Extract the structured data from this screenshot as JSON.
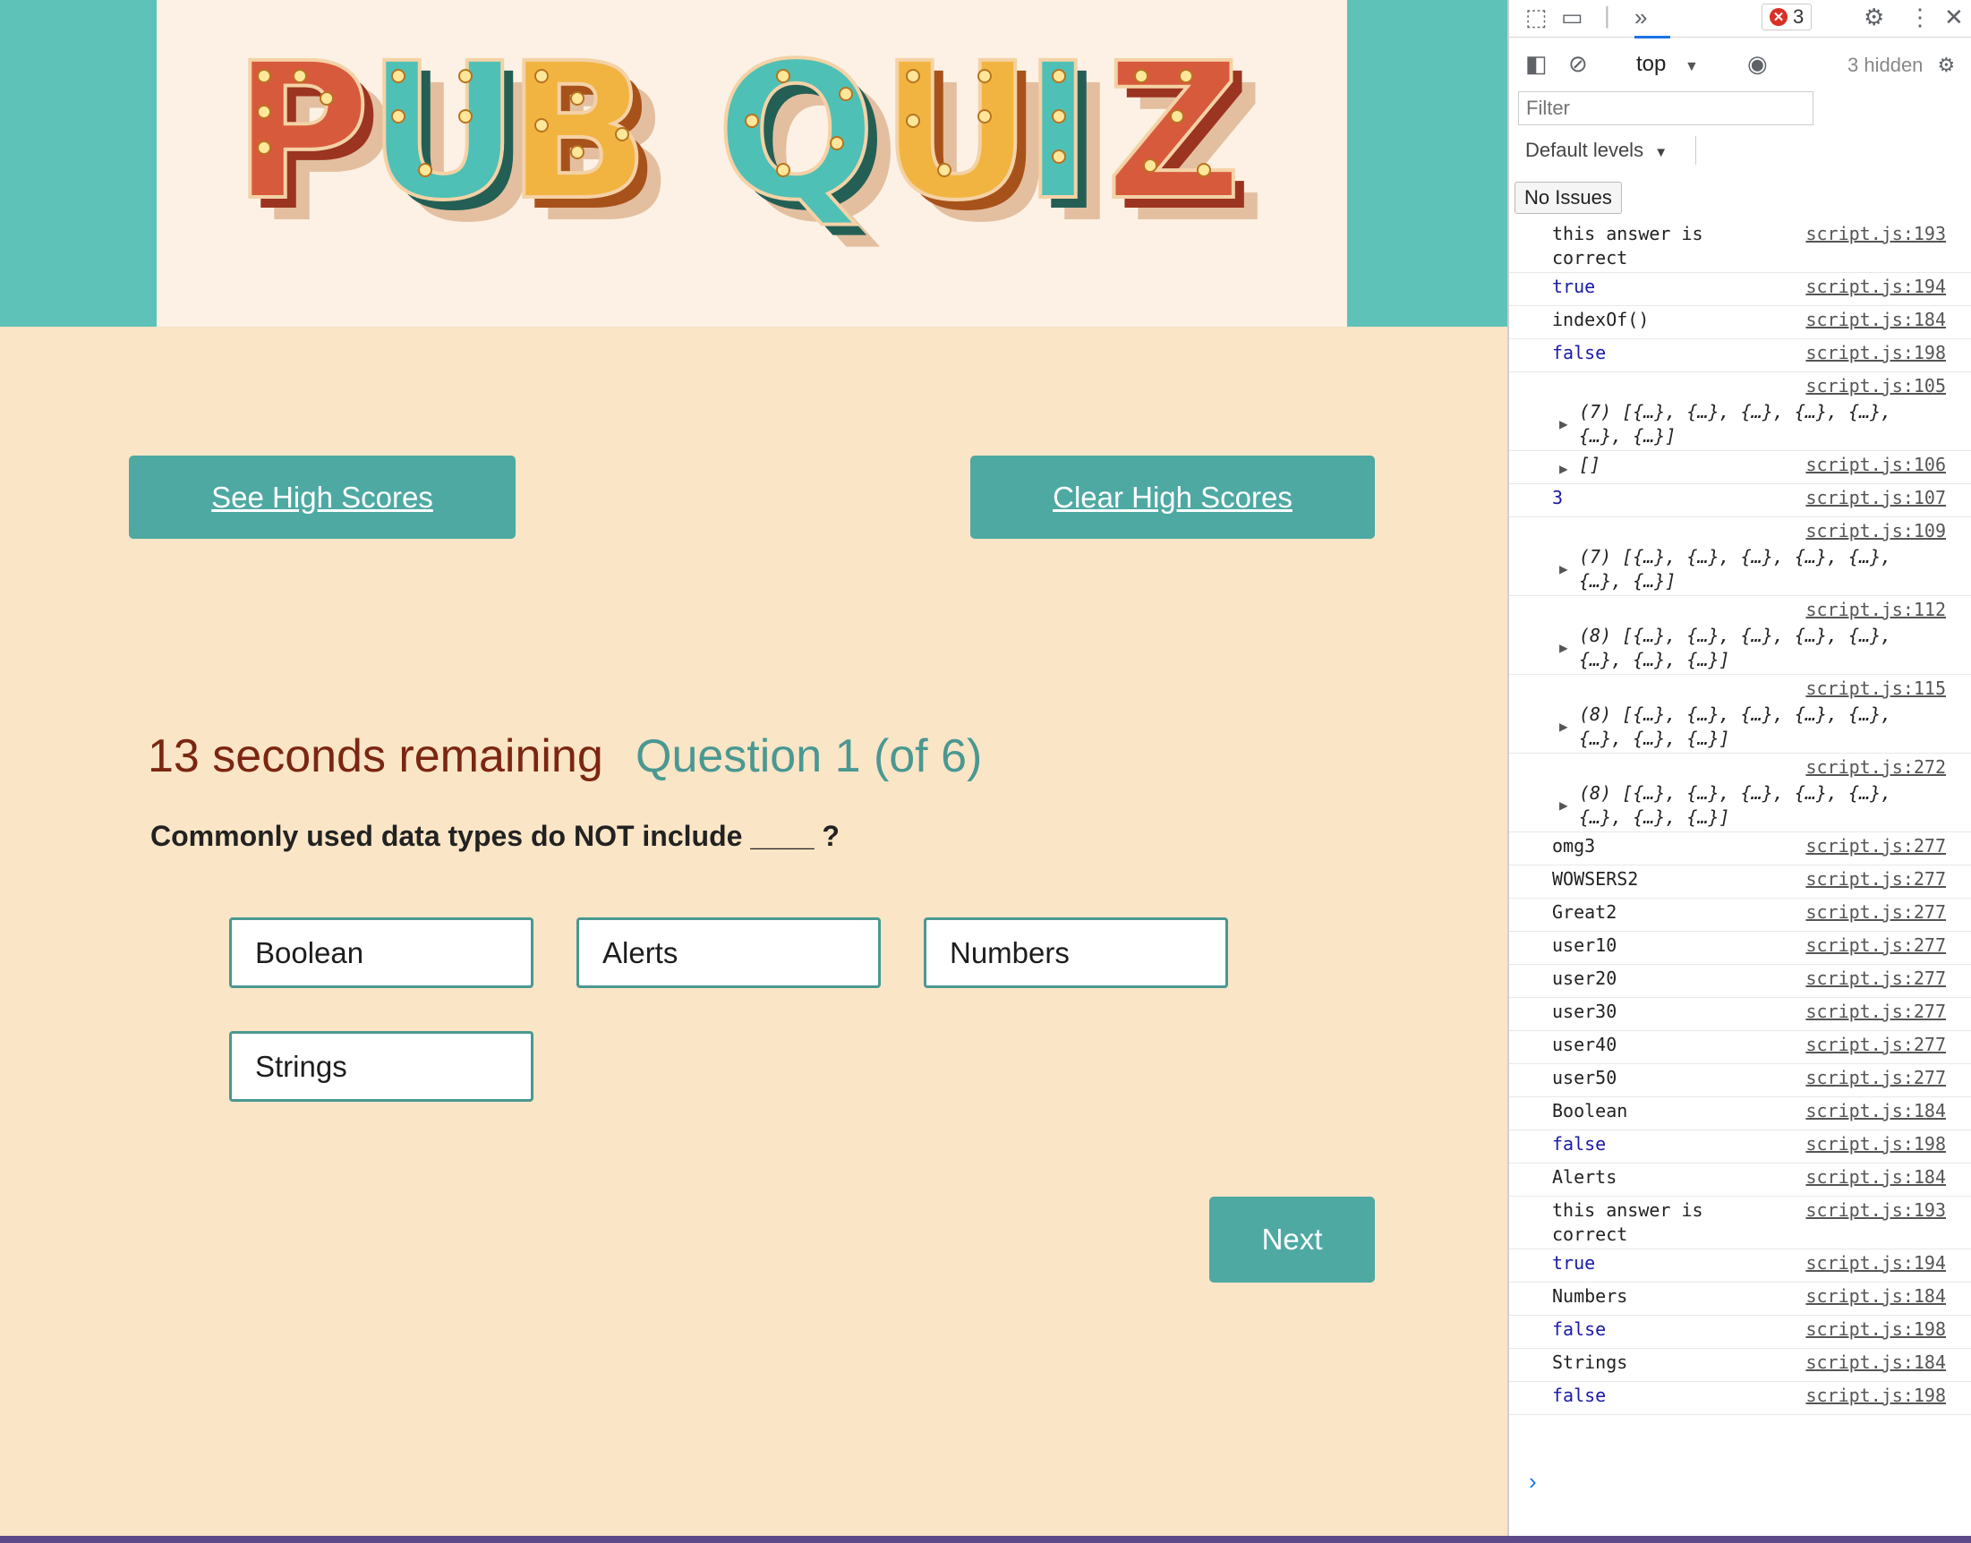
{
  "banner": {
    "logo_text": "PUB QUIZ"
  },
  "buttons": {
    "see_high_scores": "See High Scores",
    "clear_high_scores": "Clear High Scores",
    "next": "Next"
  },
  "quiz": {
    "timer": "13 seconds remaining",
    "question_number": "Question 1 (of 6)",
    "question": "Commonly used data types do NOT include ____ ?",
    "answers": [
      "Boolean",
      "Alerts",
      "Numbers",
      "Strings"
    ]
  },
  "devtools": {
    "error_count": "3",
    "context": "top",
    "hidden": "3 hidden",
    "filter_placeholder": "Filter",
    "levels": "Default levels",
    "issues": "No Issues",
    "logs": [
      {
        "msg": "this answer is\ncorrect",
        "src": "script.js:193",
        "kind": "text"
      },
      {
        "msg": "true",
        "src": "script.js:194",
        "kind": "bool"
      },
      {
        "msg": "indexOf()",
        "src": "script.js:184",
        "kind": "text"
      },
      {
        "msg": "false",
        "src": "script.js:198",
        "kind": "bool"
      },
      {
        "msg": "(7) [{…}, {…}, {…}, {…}, {…},\n{…}, {…}]",
        "src": "script.js:105",
        "kind": "expand"
      },
      {
        "msg": "[]",
        "src": "script.js:106",
        "kind": "inline-expand"
      },
      {
        "msg": "3",
        "src": "script.js:107",
        "kind": "num"
      },
      {
        "msg": "(7) [{…}, {…}, {…}, {…}, {…},\n{…}, {…}]",
        "src": "script.js:109",
        "kind": "expand"
      },
      {
        "msg": "(8) [{…}, {…}, {…}, {…}, {…},\n{…}, {…}, {…}]",
        "src": "script.js:112",
        "kind": "expand"
      },
      {
        "msg": "(8) [{…}, {…}, {…}, {…}, {…},\n{…}, {…}, {…}]",
        "src": "script.js:115",
        "kind": "expand"
      },
      {
        "msg": "(8) [{…}, {…}, {…}, {…}, {…},\n{…}, {…}, {…}]",
        "src": "script.js:272",
        "kind": "expand"
      },
      {
        "msg": "omg3",
        "src": "script.js:277",
        "kind": "text"
      },
      {
        "msg": "WOWSERS2",
        "src": "script.js:277",
        "kind": "text"
      },
      {
        "msg": "Great2",
        "src": "script.js:277",
        "kind": "text"
      },
      {
        "msg": "user10",
        "src": "script.js:277",
        "kind": "text"
      },
      {
        "msg": "user20",
        "src": "script.js:277",
        "kind": "text"
      },
      {
        "msg": "user30",
        "src": "script.js:277",
        "kind": "text"
      },
      {
        "msg": "user40",
        "src": "script.js:277",
        "kind": "text"
      },
      {
        "msg": "user50",
        "src": "script.js:277",
        "kind": "text"
      },
      {
        "msg": "Boolean",
        "src": "script.js:184",
        "kind": "text"
      },
      {
        "msg": "false",
        "src": "script.js:198",
        "kind": "bool"
      },
      {
        "msg": "Alerts",
        "src": "script.js:184",
        "kind": "text"
      },
      {
        "msg": "this answer is\ncorrect",
        "src": "script.js:193",
        "kind": "text"
      },
      {
        "msg": "true",
        "src": "script.js:194",
        "kind": "bool"
      },
      {
        "msg": "Numbers",
        "src": "script.js:184",
        "kind": "text"
      },
      {
        "msg": "false",
        "src": "script.js:198",
        "kind": "bool"
      },
      {
        "msg": "Strings",
        "src": "script.js:184",
        "kind": "text"
      },
      {
        "msg": "false",
        "src": "script.js:198",
        "kind": "bool"
      }
    ]
  },
  "colors": {
    "teal": "#5fc2b8",
    "button": "#4ea9a3",
    "page_bg": "#fae5c6",
    "timer": "#7b2612",
    "question_number": "#4a9892"
  }
}
